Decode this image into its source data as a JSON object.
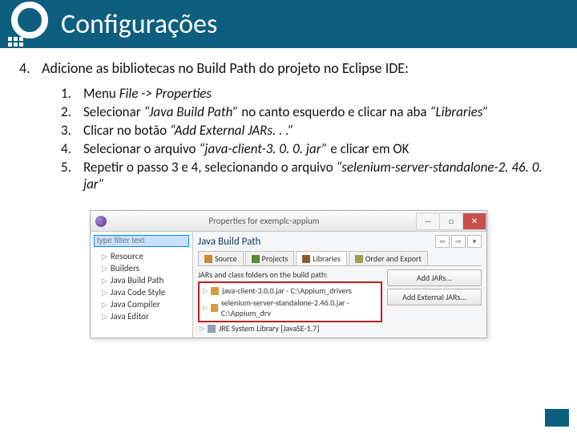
{
  "header": {
    "title": "Configurações"
  },
  "main_step": {
    "num": "4.",
    "text": "Adicione as bibliotecas no Build Path do projeto no Eclipse IDE:"
  },
  "subs": [
    {
      "n": "1.",
      "html": "Menu <i>File -> Properties</i>"
    },
    {
      "n": "2.",
      "html": "Selecionar <i>“Java Build Path”</i> no canto esquerdo e clicar na aba <i>“Libraries”</i>"
    },
    {
      "n": "3.",
      "html": "Clicar no botão <i>“Add External JARs. . .”</i>"
    },
    {
      "n": "4.",
      "html": "Selecionar o arquivo <i>“java-client-3. 0. 0. jar”</i> e clicar em OK"
    },
    {
      "n": "5.",
      "html": "Repetir o passo 3 e 4, selecionando o arquivo <i>“selenium-server-standalone-2. 46. 0. jar”</i>"
    }
  ],
  "dialog": {
    "title": "Properties for exemplc-appium",
    "filter_placeholder": "type filter text",
    "tree": [
      "Resource",
      "Builders",
      "Java Build Path",
      "Java Code Style",
      "Java Compiler",
      "Java Editor"
    ],
    "section": "Java Build Path",
    "tabs": {
      "source": "Source",
      "projects": "Projects",
      "libraries": "Libraries",
      "order": "Order and Export"
    },
    "list_label": "JARs and class folders on the build path:",
    "jars": [
      "java-client-3.0.0.jar - C:\\Appium_drivers",
      "selenium-server-standalone-2.46.0.jar - C:\\Appium_drv"
    ],
    "jre": "JRE System Library [JavaSE-1.7]",
    "buttons": {
      "add_jars": "Add JARs...",
      "add_ext": "Add External JARs..."
    }
  }
}
